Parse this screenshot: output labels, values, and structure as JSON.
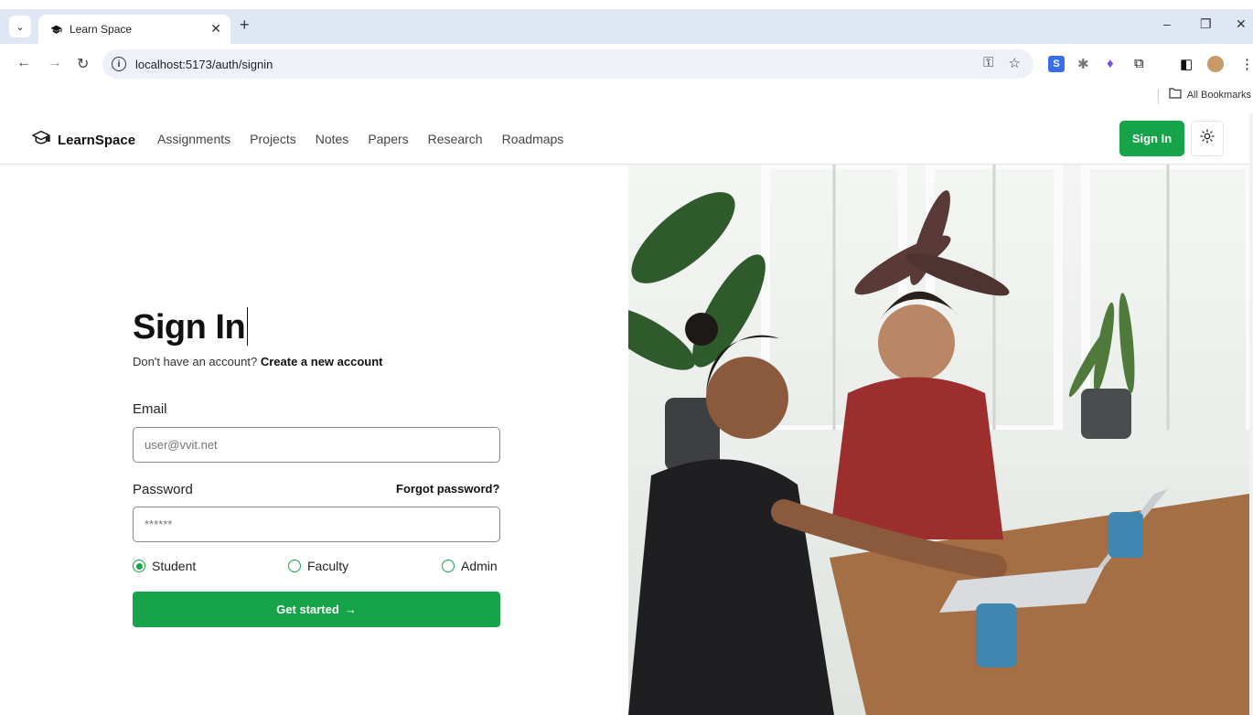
{
  "browser": {
    "tab_title": "Learn Space",
    "url": "localhost:5173/auth/signin",
    "bookmarks_label": "All Bookmarks"
  },
  "nav": {
    "brand": "LearnSpace",
    "links": [
      "Assignments",
      "Projects",
      "Notes",
      "Papers",
      "Research",
      "Roadmaps"
    ],
    "signin_label": "Sign In"
  },
  "form": {
    "title": "Sign In",
    "subtitle_text": "Don't have an account?",
    "subtitle_link": "Create a new account",
    "email_label": "Email",
    "email_placeholder": "user@vvit.net",
    "password_label": "Password",
    "forgot_label": "Forgot password?",
    "password_value": "******",
    "roles": [
      {
        "label": "Student",
        "selected": true
      },
      {
        "label": "Faculty",
        "selected": false
      },
      {
        "label": "Admin",
        "selected": false
      }
    ],
    "submit_label": "Get started",
    "submit_arrow": "→"
  },
  "colors": {
    "accent": "#16a34a"
  },
  "icons": {
    "brand": "graduation-cap-icon",
    "theme": "sun-icon"
  }
}
